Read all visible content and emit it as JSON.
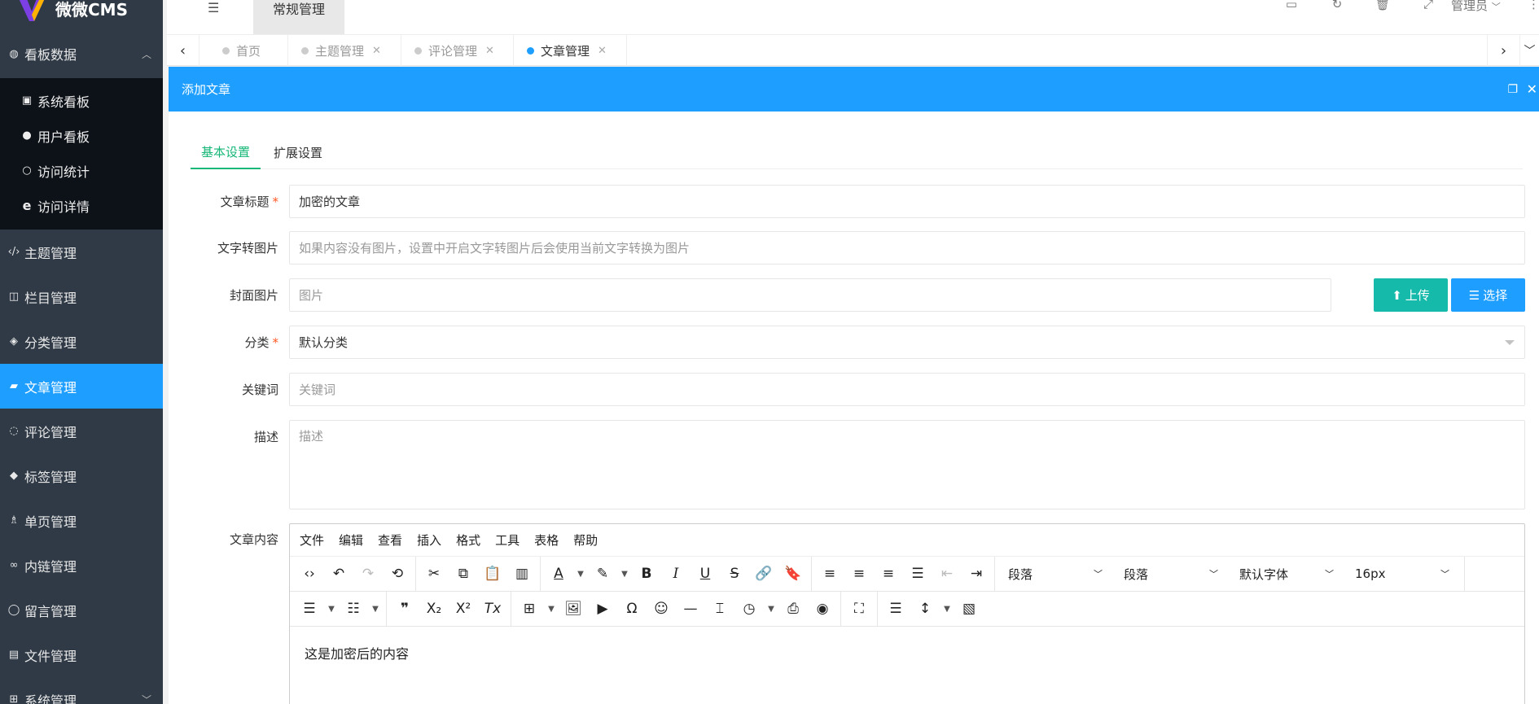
{
  "app": {
    "name": "微微CMS"
  },
  "sidebar": {
    "group": {
      "label": "看板数据",
      "items": [
        {
          "label": "系统看板"
        },
        {
          "label": "用户看板"
        },
        {
          "label": "访问统计"
        },
        {
          "label": "访问详情"
        }
      ]
    },
    "items": [
      {
        "label": "主题管理"
      },
      {
        "label": "栏目管理"
      },
      {
        "label": "分类管理"
      },
      {
        "label": "文章管理"
      },
      {
        "label": "评论管理"
      },
      {
        "label": "标签管理"
      },
      {
        "label": "单页管理"
      },
      {
        "label": "内链管理"
      },
      {
        "label": "留言管理"
      },
      {
        "label": "文件管理"
      },
      {
        "label": "系统管理"
      }
    ]
  },
  "topbar": {
    "active_tab": "常规管理",
    "admin": "管理员"
  },
  "tabs": [
    {
      "label": "首页"
    },
    {
      "label": "主题管理"
    },
    {
      "label": "评论管理"
    },
    {
      "label": "文章管理"
    }
  ],
  "dialog": {
    "title": "添加文章",
    "form_tabs": [
      {
        "label": "基本设置"
      },
      {
        "label": "扩展设置"
      }
    ],
    "fields": {
      "title_label": "文章标题",
      "title_value": "加密的文章",
      "text2img_label": "文字转图片",
      "text2img_placeholder": "如果内容没有图片，设置中开启文字转图片后会使用当前文字转换为图片",
      "cover_label": "封面图片",
      "cover_placeholder": "图片",
      "upload_label": "上传",
      "choose_label": "选择",
      "category_label": "分类",
      "category_value": "默认分类",
      "keywords_label": "关键词",
      "keywords_placeholder": "关键词",
      "desc_label": "描述",
      "desc_placeholder": "描述",
      "content_label": "文章内容"
    },
    "editor": {
      "menu": [
        "文件",
        "编辑",
        "查看",
        "插入",
        "格式",
        "工具",
        "表格",
        "帮助"
      ],
      "selects": [
        "段落",
        "段落",
        "默认字体",
        "16px"
      ],
      "content": "这是加密后的内容"
    }
  },
  "colors": {
    "accent": "#1e9fff",
    "green": "#16b777",
    "sidebar": "#2f3a46",
    "submenu": "#0d1218"
  }
}
